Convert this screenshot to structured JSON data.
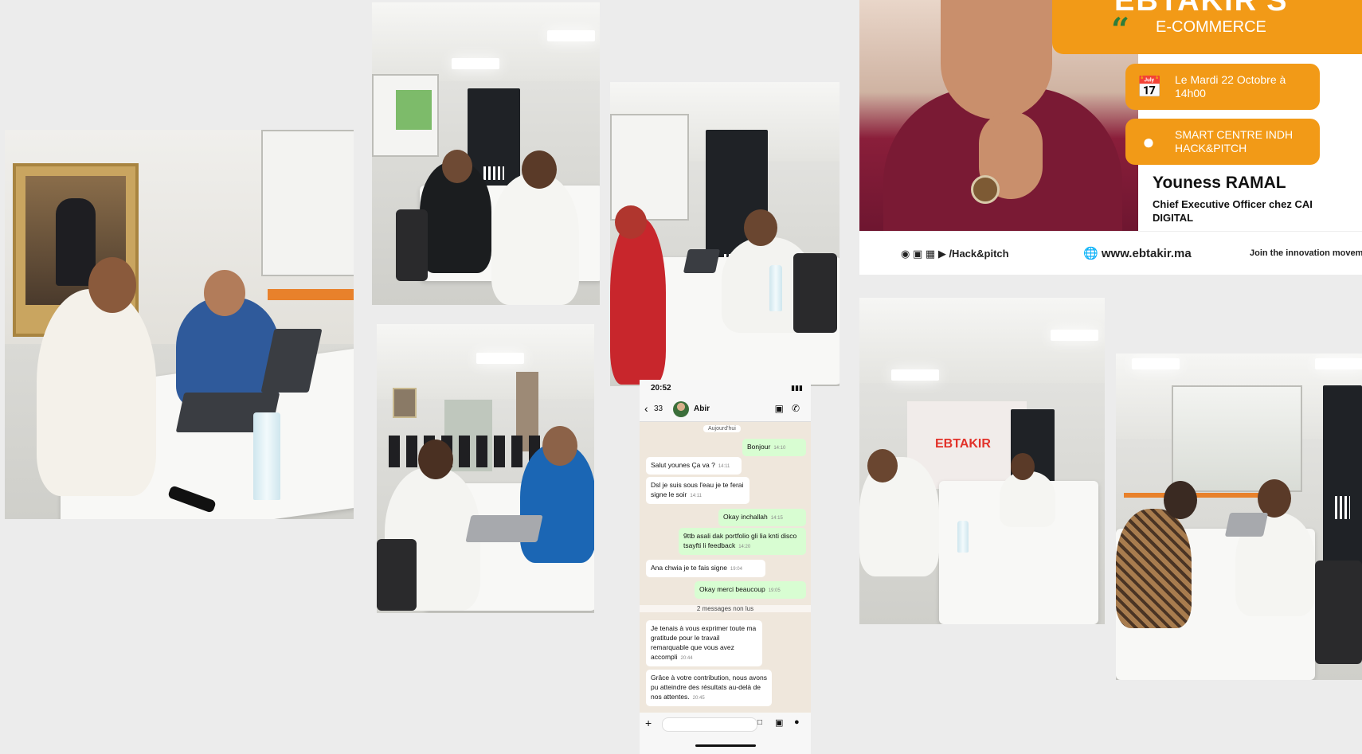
{
  "poster": {
    "headline": "EBTAKIR'S",
    "subheading": "E-COMMERCE",
    "date_info": "Le Mardi 22 Octobre à 14h00",
    "location_info": "SMART CENTRE INDH HACK&PITCH",
    "speaker_name": "Youness RAMAL",
    "speaker_role": "Chief Executive Officer chez CAI DIGITAL",
    "social_handle": "/Hack&pitch",
    "website": "www.ebtakir.ma",
    "tagline": "Join the innovation movem",
    "colors": {
      "accent": "#f29a17",
      "quote": "#2e7d3a",
      "sweater": "#7a1a34"
    }
  },
  "photos": [
    {
      "name": "meeting-photo-portrait-room",
      "icons": [
        "laptop",
        "water-bottle",
        "remote"
      ]
    },
    {
      "name": "meeting-photo-projector-room"
    },
    {
      "name": "meeting-photo-banner-room"
    },
    {
      "name": "meeting-photo-chairs-room"
    },
    {
      "name": "meeting-photo-ebtakir-wall"
    },
    {
      "name": "meeting-photo-screen-room"
    }
  ],
  "chat": {
    "status_time": "20:52",
    "back_count": "33",
    "contact_name": "Abir",
    "date_label": "Aujourd'hui",
    "unread_label": "2 messages non lus",
    "messages": [
      {
        "dir": "out",
        "text": "Bonjour",
        "time": "14:10"
      },
      {
        "dir": "in",
        "text": "Salut younes Ça va ?",
        "time": "14:11"
      },
      {
        "dir": "in",
        "text": "Dsl je suis sous l'eau je te ferai signe le soir",
        "time": "14:11"
      },
      {
        "dir": "out",
        "text": "Okay inchallah",
        "time": "14:15"
      },
      {
        "dir": "out",
        "text": "9ttb asali dak portfolio gli lia knti disco tsayfti li feedback",
        "time": "14:20"
      },
      {
        "dir": "in",
        "text": "Ana chwia je te fais signe",
        "time": "19:04"
      },
      {
        "dir": "out",
        "text": "Okay merci beaucoup",
        "time": "19:05"
      },
      {
        "dir": "in",
        "text": "Je tenais à vous exprimer toute ma gratitude pour le travail remarquable que vous avez accompli",
        "time": "20:44"
      },
      {
        "dir": "in",
        "text": "Grâce à votre contribution, nous avons pu atteindre des résultats au-delà de nos attentes.",
        "time": "20:45"
      }
    ]
  }
}
